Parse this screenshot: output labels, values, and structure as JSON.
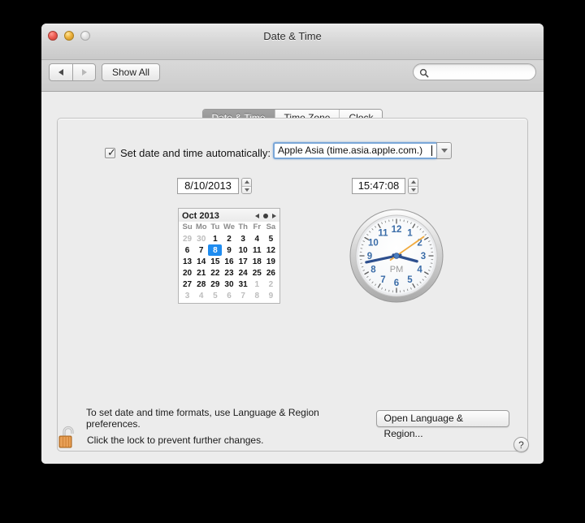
{
  "window": {
    "title": "Date & Time",
    "traffic_lights": [
      "close-button",
      "minimize-button",
      "zoom-button"
    ]
  },
  "toolbar": {
    "back_label": "back-arrow",
    "forward_label": "forward-arrow",
    "show_all_label": "Show All",
    "search_placeholder": "",
    "search_value": ""
  },
  "tabs": [
    {
      "label": "Date & Time",
      "active": true
    },
    {
      "label": "Time Zone",
      "active": false
    },
    {
      "label": "Clock",
      "active": false
    }
  ],
  "auto_sync": {
    "checkbox_checked": true,
    "checkbox_glyph": "✓",
    "label": "Set date and time automatically:",
    "server_value": "Apple Asia (time.asia.apple.com.)"
  },
  "date_field": {
    "value": "8/10/2013"
  },
  "time_field": {
    "value": "15:47:08"
  },
  "calendar": {
    "title": "Oct 2013",
    "weekdays": [
      "Su",
      "Mo",
      "Tu",
      "We",
      "Th",
      "Fr",
      "Sa"
    ],
    "weeks": [
      [
        {
          "d": "29",
          "out": true
        },
        {
          "d": "30",
          "out": true
        },
        {
          "d": "1"
        },
        {
          "d": "2"
        },
        {
          "d": "3"
        },
        {
          "d": "4"
        },
        {
          "d": "5"
        }
      ],
      [
        {
          "d": "6"
        },
        {
          "d": "7"
        },
        {
          "d": "8",
          "selected": true
        },
        {
          "d": "9"
        },
        {
          "d": "10"
        },
        {
          "d": "11"
        },
        {
          "d": "12"
        }
      ],
      [
        {
          "d": "13"
        },
        {
          "d": "14"
        },
        {
          "d": "15"
        },
        {
          "d": "16"
        },
        {
          "d": "17"
        },
        {
          "d": "18"
        },
        {
          "d": "19"
        }
      ],
      [
        {
          "d": "20"
        },
        {
          "d": "21"
        },
        {
          "d": "22"
        },
        {
          "d": "23"
        },
        {
          "d": "24"
        },
        {
          "d": "25"
        },
        {
          "d": "26"
        }
      ],
      [
        {
          "d": "27"
        },
        {
          "d": "28"
        },
        {
          "d": "29"
        },
        {
          "d": "30"
        },
        {
          "d": "31"
        },
        {
          "d": "1",
          "out": true
        },
        {
          "d": "2",
          "out": true
        }
      ],
      [
        {
          "d": "3",
          "out": true
        },
        {
          "d": "4",
          "out": true
        },
        {
          "d": "5",
          "out": true
        },
        {
          "d": "6",
          "out": true
        },
        {
          "d": "7",
          "out": true
        },
        {
          "d": "8",
          "out": true
        },
        {
          "d": "9",
          "out": true
        }
      ]
    ],
    "selected_day": "8"
  },
  "clock": {
    "meridiem": "PM",
    "hour_angle": 105,
    "minute_angle": 258,
    "second_angle": 55,
    "hour_numerals": [
      "12",
      "1",
      "2",
      "3",
      "4",
      "5",
      "6",
      "7",
      "8",
      "9",
      "10",
      "11"
    ],
    "hand_color": "#2d4f8e",
    "second_hand_color": "#f0a93c"
  },
  "formats_hint": {
    "text": "To set date and time formats, use Language & Region preferences.",
    "button_label": "Open Language & Region..."
  },
  "footer": {
    "lock_state": "unlocked",
    "lock_label": "Click the lock to prevent further changes.",
    "help_label": "?"
  },
  "colors": {
    "accent": "#1e8cf0",
    "window_bg": "#ececec",
    "tab_active_bg": "#8f8f8f",
    "focus_ring": "#7aa7d8"
  }
}
